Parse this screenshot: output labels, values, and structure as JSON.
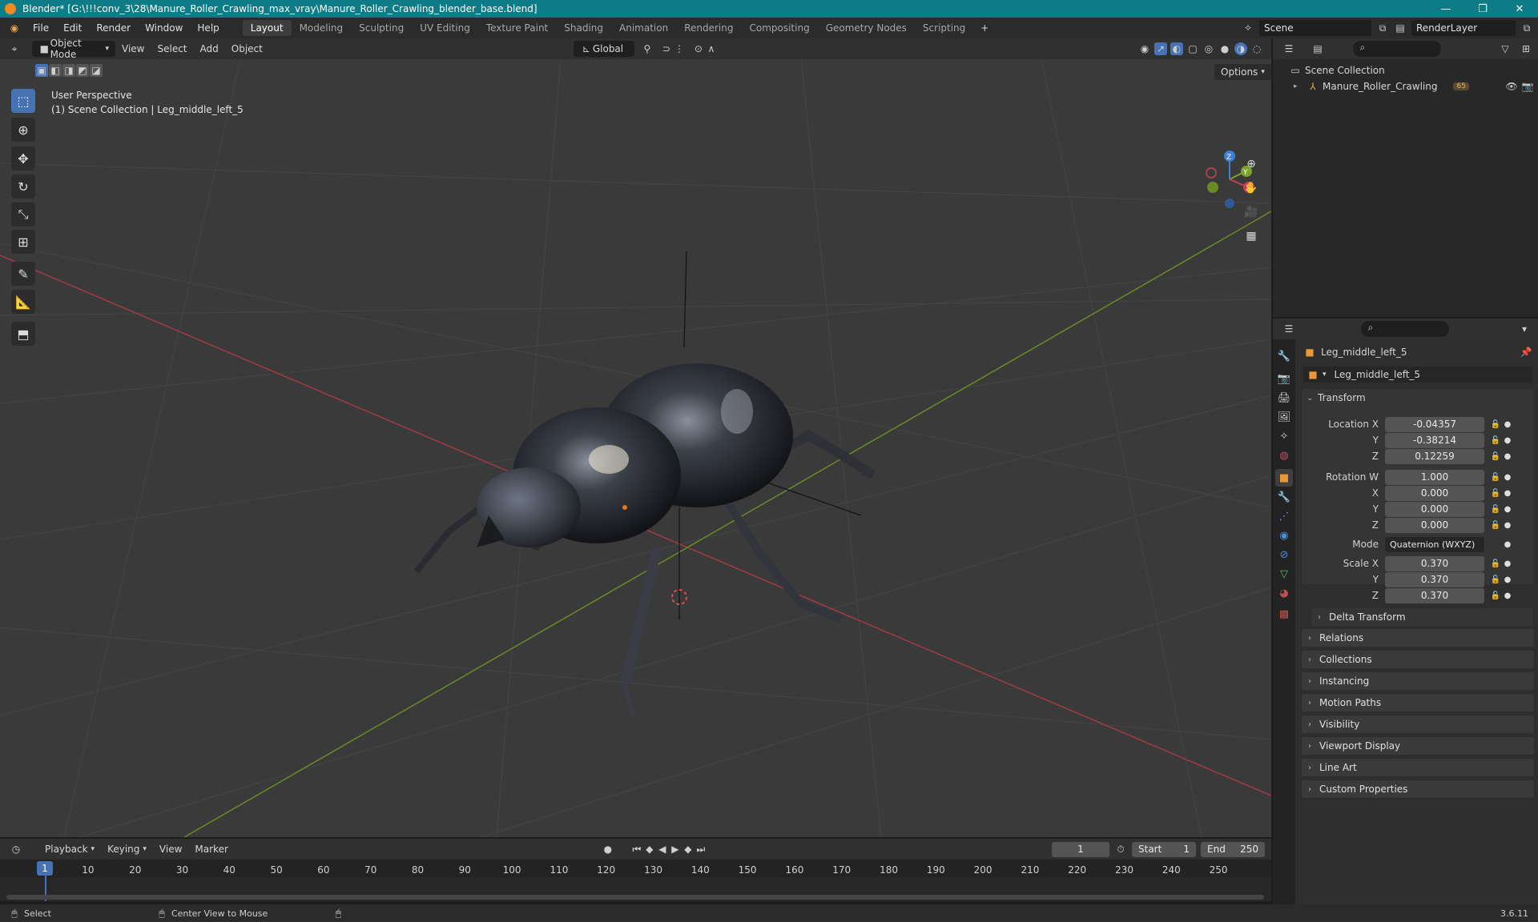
{
  "window": {
    "title": "Blender* [G:\\!!!conv_3\\28\\Manure_Roller_Crawling_max_vray\\Manure_Roller_Crawling_blender_base.blend]",
    "controls": [
      "—",
      "❐",
      "✕"
    ]
  },
  "menu": [
    "File",
    "Edit",
    "Render",
    "Window",
    "Help"
  ],
  "workspaces": [
    "Layout",
    "Modeling",
    "Sculpting",
    "UV Editing",
    "Texture Paint",
    "Shading",
    "Animation",
    "Rendering",
    "Compositing",
    "Geometry Nodes",
    "Scripting"
  ],
  "active_workspace": "Layout",
  "scene_name": "Scene",
  "render_layer": "RenderLayer",
  "viewport_header": {
    "mode": "Object Mode",
    "menus": [
      "View",
      "Select",
      "Add",
      "Object"
    ],
    "orientation": "Global",
    "options_label": "Options"
  },
  "viewport": {
    "perspective": "User Perspective",
    "context": "(1) Scene Collection | Leg_middle_left_5",
    "gizmo": {
      "x": "X",
      "y": "Y",
      "z": "Z"
    }
  },
  "outliner": {
    "root": "Scene Collection",
    "items": [
      {
        "name": "Manure_Roller_Crawling",
        "badge": "65"
      }
    ]
  },
  "properties": {
    "object_name": "Leg_middle_left_5",
    "datablock": "Leg_middle_left_5",
    "transform_label": "Transform",
    "location": {
      "label": "Location X",
      "x": "-0.04357",
      "y": "-0.38214",
      "z": "0.12259"
    },
    "rotation": {
      "label": "Rotation W",
      "w": "1.000",
      "x": "0.000",
      "y": "0.000",
      "z": "0.000"
    },
    "mode": {
      "label": "Mode",
      "value": "Quaternion (WXYZ)"
    },
    "scale": {
      "label": "Scale X",
      "x": "0.370",
      "y": "0.370",
      "z": "0.370"
    },
    "axis_labels": {
      "y": "Y",
      "z": "Z",
      "x": "X"
    },
    "delta": "Delta Transform",
    "panels": [
      "Relations",
      "Collections",
      "Instancing",
      "Motion Paths",
      "Visibility",
      "Viewport Display",
      "Line Art",
      "Custom Properties"
    ]
  },
  "timeline": {
    "menus": [
      "Playback",
      "Keying",
      "View",
      "Marker"
    ],
    "current_frame": "1",
    "start_label": "Start",
    "start": "1",
    "end_label": "End",
    "end": "250",
    "ticks": [
      "10",
      "20",
      "30",
      "40",
      "50",
      "60",
      "70",
      "80",
      "90",
      "100",
      "110",
      "120",
      "130",
      "140",
      "150",
      "160",
      "170",
      "180",
      "190",
      "200",
      "210",
      "220",
      "230",
      "240",
      "250"
    ],
    "playhead": "1"
  },
  "status": {
    "select": "Select",
    "center": "Center View to Mouse",
    "version": "3.6.11"
  },
  "colors": {
    "accent": "#4772b3",
    "titlebar": "#0e7c86",
    "x_axis": "#c8424f",
    "y_axis": "#7ea22b",
    "z_axis": "#3d7ed6"
  }
}
